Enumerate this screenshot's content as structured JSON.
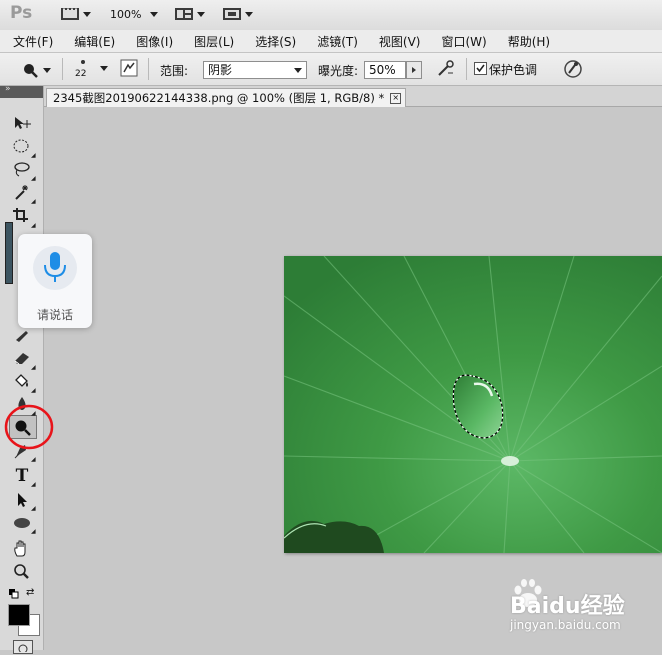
{
  "app": {
    "logo": "Ps",
    "zoom": "100%"
  },
  "menu": [
    "文件(F)",
    "编辑(E)",
    "图像(I)",
    "图层(L)",
    "选择(S)",
    "滤镜(T)",
    "视图(V)",
    "窗口(W)",
    "帮助(H)"
  ],
  "options": {
    "brush_size": "22",
    "range_label": "范围:",
    "range_value": "阴影",
    "exposure_label": "曝光度:",
    "exposure_value": "50%",
    "protect_tones_label": "保护色调",
    "protect_tones_checked": true
  },
  "document_tab": {
    "title": "2345截图20190622144338.png @ 100% (图层 1, RGB/8) *",
    "close": "×"
  },
  "tools": [
    "move-tool",
    "marquee-tool",
    "lasso-tool",
    "magic-wand-tool",
    "crop-tool",
    "eyedropper-tool",
    "healing-brush-tool",
    "brush-tool",
    "clone-stamp-tool",
    "history-brush-tool",
    "eraser-tool",
    "paint-bucket-tool",
    "blur-tool",
    "burn-tool",
    "pen-tool",
    "type-tool",
    "path-selection-tool",
    "ellipse-tool",
    "hand-tool",
    "zoom-tool"
  ],
  "type_tool_glyph": "T",
  "voice_popup": {
    "label": "请说话"
  },
  "highlight": {
    "color": "#e8141a",
    "target": "burn-tool"
  },
  "watermark": {
    "main": "Baidu经验",
    "url": "jingyan.baidu.com"
  },
  "colors": {
    "foreground": "#000000",
    "background": "#ffffff",
    "leaf": "#3f9a45"
  }
}
